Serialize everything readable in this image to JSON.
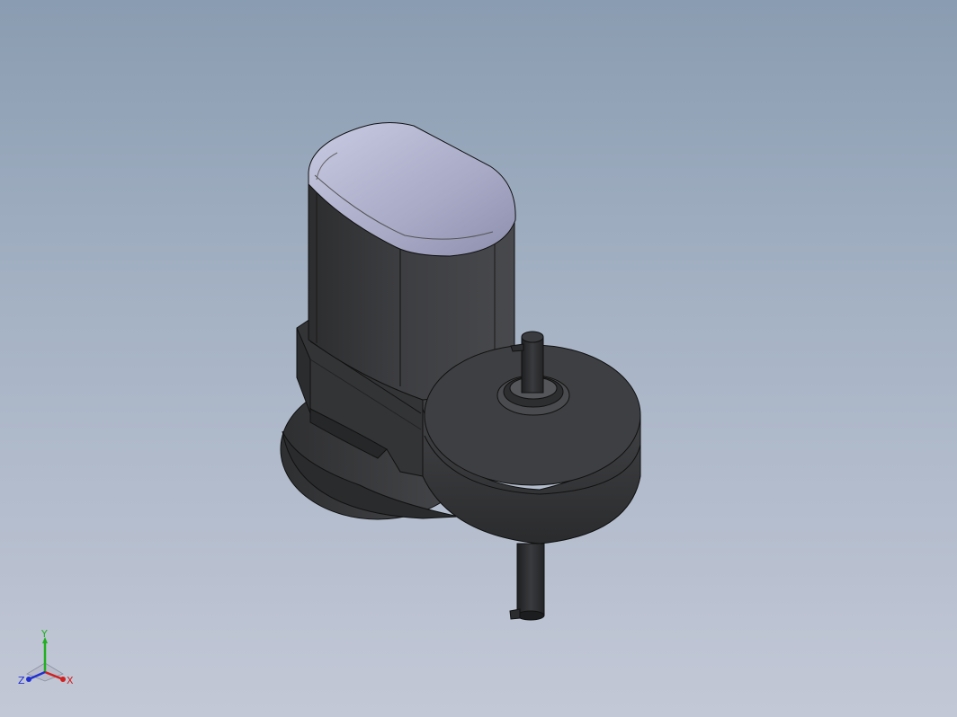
{
  "viewport": {
    "background_top": "#8a9cb1",
    "background_bottom": "#c3c8d6"
  },
  "model": {
    "body_color": "#3a3b3d",
    "cap_color": "#aeb0cc",
    "edge_color": "#111111"
  },
  "triad": {
    "x_label": "X",
    "y_label": "Y",
    "z_label": "Z",
    "x_color": "#d02020",
    "y_color": "#20b020",
    "z_color": "#2030d0"
  }
}
